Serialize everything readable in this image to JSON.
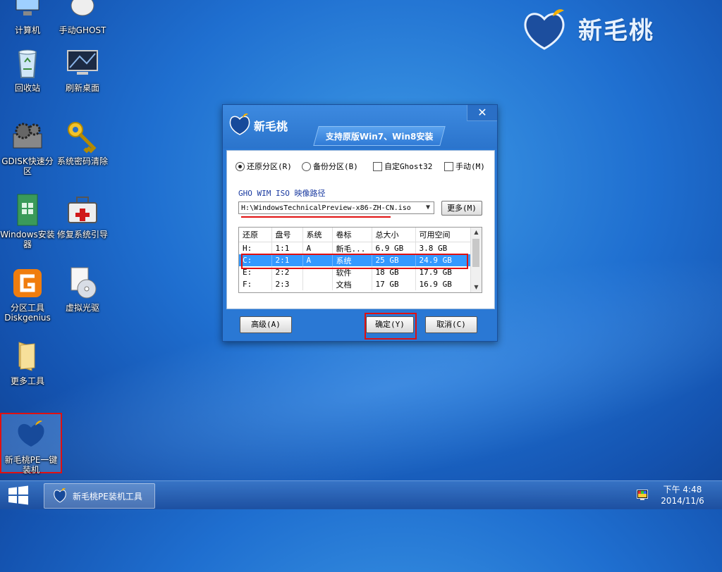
{
  "brand": {
    "name": "新毛桃"
  },
  "desktop_icons": [
    {
      "id": "computer",
      "label": "计算机"
    },
    {
      "id": "manual-ghost",
      "label": "手动GHOST"
    },
    {
      "id": "recycle-bin",
      "label": "回收站"
    },
    {
      "id": "refresh-desktop",
      "label": "刷新桌面"
    },
    {
      "id": "gdisk",
      "label": "GDISK快速分区"
    },
    {
      "id": "password-clear",
      "label": "系统密码清除"
    },
    {
      "id": "windows-installer",
      "label": "Windows安装器"
    },
    {
      "id": "boot-repair",
      "label": "修复系统引导"
    },
    {
      "id": "diskgenius",
      "label": "分区工具Diskgenius"
    },
    {
      "id": "virtual-drive",
      "label": "虚拟光驱"
    },
    {
      "id": "more-tools",
      "label": "更多工具"
    },
    {
      "id": "pe-installer",
      "label": "新毛桃PE一键装机"
    }
  ],
  "dialog": {
    "brand_name": "新毛桃",
    "banner": "支持原版Win7、Win8安装",
    "close": "✕",
    "options": {
      "restore": "还原分区(R)",
      "backup": "备份分区(B)",
      "custom_ghost": "自定Ghost32",
      "manual": "手动(M)"
    },
    "path_label": "GHO WIM ISO 映像路径",
    "path_value": "H:\\WindowsTechnicalPreview-x86-ZH-CN.iso",
    "more_button": "更多(M)",
    "table": {
      "headers": [
        "还原",
        "盘号",
        "系统",
        "卷标",
        "总大小",
        "可用空间"
      ],
      "rows": [
        [
          "H:",
          "1:1",
          "A",
          "新毛...",
          "6.9 GB",
          "3.8 GB"
        ],
        [
          "C:",
          "2:1",
          "A",
          "系统",
          "25 GB",
          "24.9 GB"
        ],
        [
          "E:",
          "2:2",
          "",
          "软件",
          "18 GB",
          "17.9 GB"
        ],
        [
          "F:",
          "2:3",
          "",
          "文档",
          "17 GB",
          "16.9 GB"
        ]
      ]
    },
    "buttons": {
      "advanced": "高级(A)",
      "confirm": "确定(Y)",
      "cancel": "取消(C)"
    }
  },
  "taskbar": {
    "task": "新毛桃PE装机工具",
    "time": "下午 4:48",
    "date": "2014/11/6"
  },
  "colors": {
    "accent_red": "#e01010",
    "selection_blue": "#3399ff",
    "dialog_blue": "#2a78d4"
  }
}
